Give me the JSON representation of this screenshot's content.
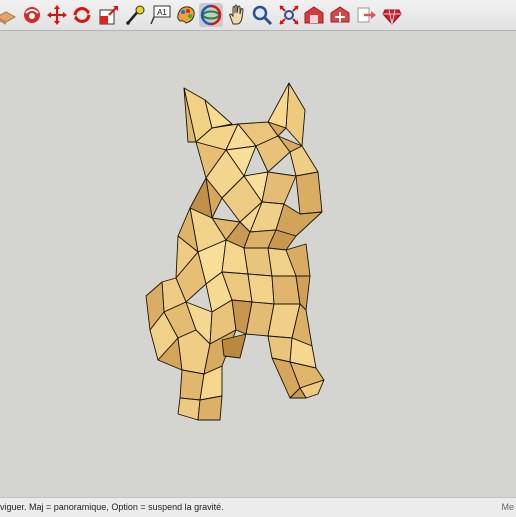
{
  "toolbar": {
    "tools": [
      {
        "name": "make-component-icon",
        "active": false
      },
      {
        "name": "paint-bucket-icon",
        "active": false
      },
      {
        "name": "move-icon",
        "active": false
      },
      {
        "name": "rotate-icon",
        "active": false
      },
      {
        "name": "scale-icon",
        "active": false
      },
      {
        "name": "tape-measure-icon",
        "active": false
      },
      {
        "name": "text-icon",
        "label": "A1",
        "active": false
      },
      {
        "name": "paint-icon",
        "active": false
      },
      {
        "name": "orbit-icon",
        "active": true
      },
      {
        "name": "pan-icon",
        "active": false
      },
      {
        "name": "zoom-icon",
        "active": false
      },
      {
        "name": "zoom-extents-icon",
        "active": false
      },
      {
        "name": "warehouse-icon",
        "active": false
      },
      {
        "name": "share-model-icon",
        "active": false
      },
      {
        "name": "send-to-layout-icon",
        "active": false
      },
      {
        "name": "extension-warehouse-icon",
        "active": false
      }
    ]
  },
  "status": {
    "text": "viguer. Maj = panoramique, Option =  suspend la gravité.",
    "right": "Me"
  },
  "colors": {
    "face_light": "#f6d98c",
    "face_mid": "#e8c278",
    "face_dark": "#c99a55",
    "edge": "#1a1408"
  }
}
